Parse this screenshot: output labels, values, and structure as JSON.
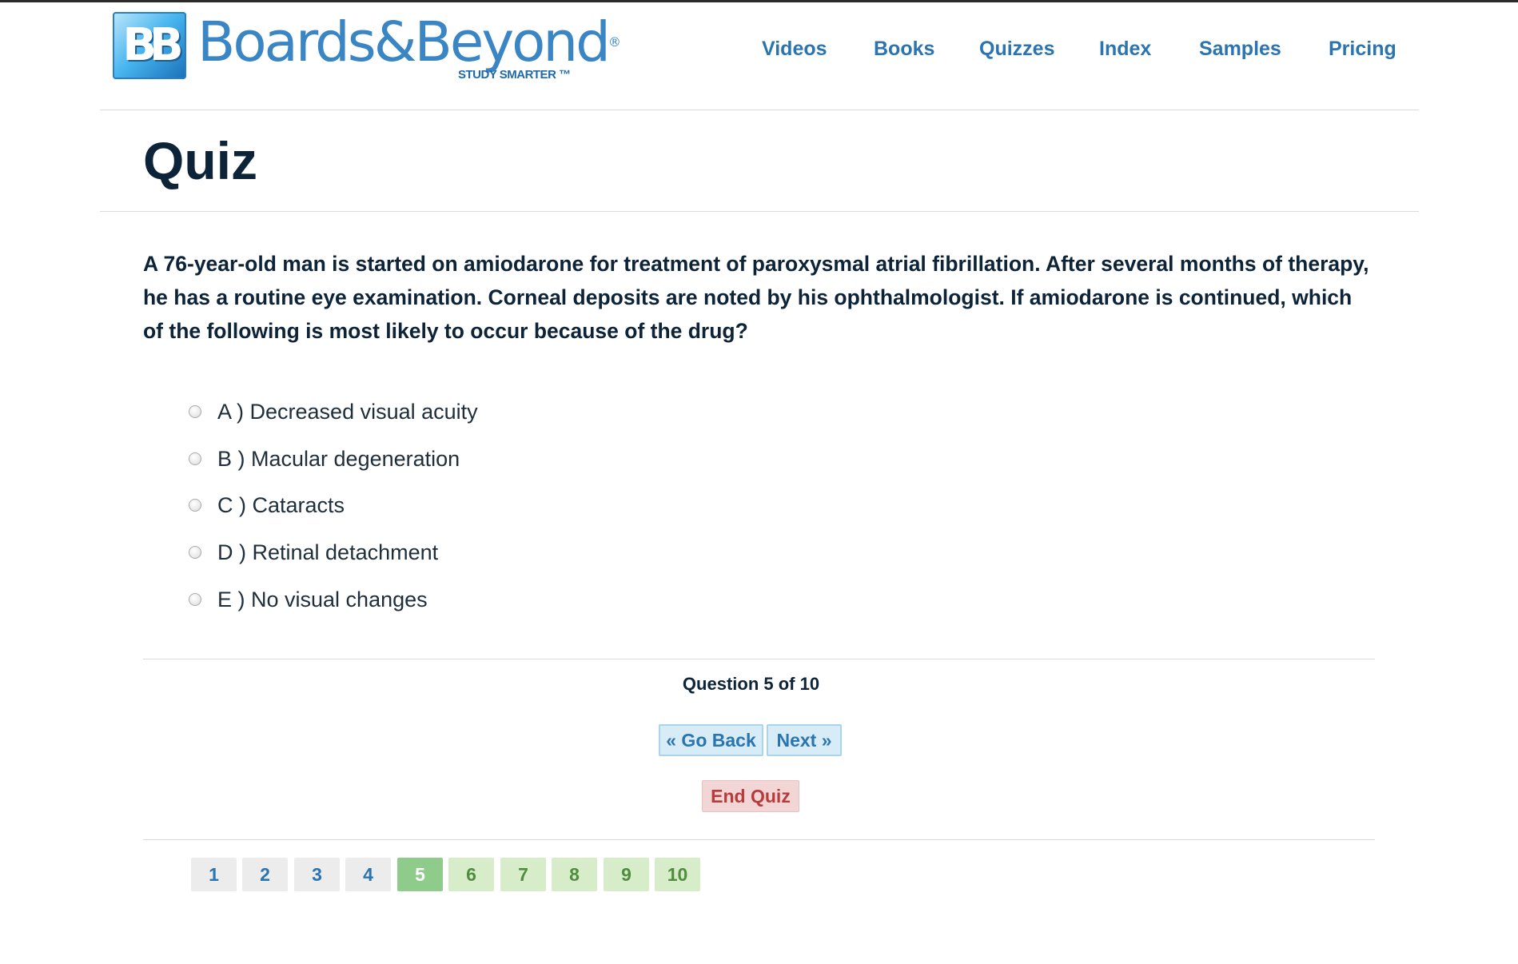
{
  "brand": {
    "mark_text": "BB",
    "name": "Boards&Beyond",
    "registered": "®",
    "tagline": "STUDY SMARTER ™"
  },
  "nav": {
    "items": [
      "Videos",
      "Books",
      "Quizzes",
      "Index",
      "Samples",
      "Pricing"
    ]
  },
  "page": {
    "title": "Quiz"
  },
  "quiz": {
    "question": "A 76-year-old man is started on amiodarone for treatment of paroxysmal atrial fibrillation. After several months of therapy, he has a routine eye examination. Corneal deposits are noted by his ophthalmologist. If amiodarone is continued, which of the following is most likely to occur because of the drug?",
    "options": [
      "A ) Decreased visual acuity",
      "B ) Macular degeneration",
      "C ) Cataracts",
      "D ) Retinal detachment",
      "E ) No visual changes"
    ],
    "counter": "Question 5 of 10",
    "buttons": {
      "go_back": "« Go Back",
      "next": "Next »",
      "end_quiz": "End Quiz"
    },
    "pages": [
      "1",
      "2",
      "3",
      "4",
      "5",
      "6",
      "7",
      "8",
      "9",
      "10"
    ],
    "current_page": 5,
    "colors": {
      "answered": "#ececec",
      "current": "#8fcc8c",
      "upcoming": "#d7ecc9"
    }
  }
}
